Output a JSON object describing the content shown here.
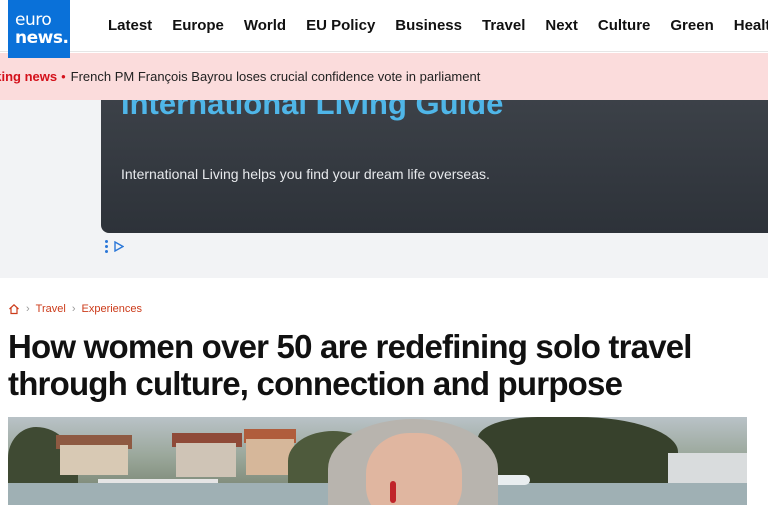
{
  "logo": {
    "line1": "euro",
    "line2": "news."
  },
  "nav": {
    "items": [
      "Latest",
      "Europe",
      "World",
      "EU Policy",
      "Business",
      "Travel",
      "Next",
      "Culture",
      "Green",
      "Health"
    ]
  },
  "breaking": {
    "label": "aking news",
    "separator": "•",
    "headline": "French PM François Bayrou loses crucial confidence vote in parliament"
  },
  "ad": {
    "title": "International Living Guide",
    "text": "International Living helps you find your dream life overseas."
  },
  "breadcrumb": {
    "items": [
      "Travel",
      "Experiences"
    ]
  },
  "article": {
    "headline": "How women over 50 are redefining solo travel through culture, connection and purpose"
  },
  "colors": {
    "brand": "#0a71d9",
    "breaking_bg": "#fbdcdc",
    "breaking_accent": "#d4111b",
    "breadcrumb": "#cc3b1a",
    "ad_title": "#4fb6e8"
  }
}
